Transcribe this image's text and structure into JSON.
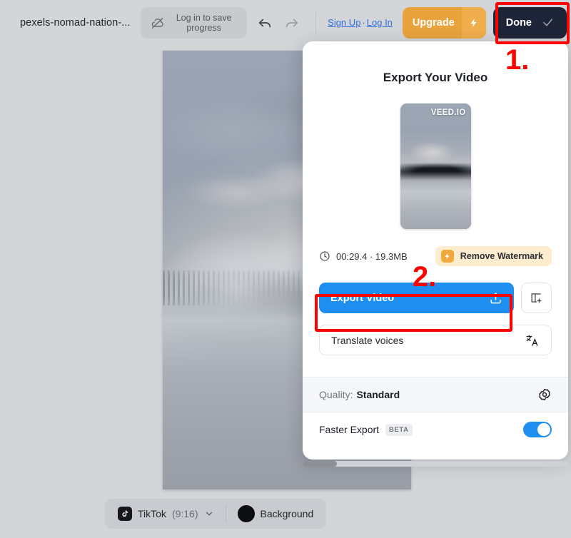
{
  "header": {
    "project_title": "pexels-nomad-nation-...",
    "save_pill": {
      "label": "Log in to save progress",
      "icon": "cloud-off-icon"
    },
    "undo_icon": "undo-arrow-icon",
    "redo_icon": "redo-arrow-icon",
    "auth": {
      "sign_up": "Sign Up",
      "separator": "·",
      "log_in": "Log In"
    },
    "upgrade": {
      "label": "Upgrade",
      "icon": "lightning-bolt-icon",
      "color": "#e8a33d"
    },
    "done": {
      "label": "Done",
      "icon": "check-icon",
      "color": "#1f2539"
    }
  },
  "panel": {
    "title": "Export Your Video",
    "thumbnail": {
      "watermark": "VEED.IO"
    },
    "meta": {
      "clock_icon": "clock-icon",
      "duration_size": "00:29.4 · 19.3MB"
    },
    "remove_watermark": {
      "label": "Remove Watermark",
      "icon": "lightning-bolt-icon"
    },
    "export_button": {
      "label": "Export Video",
      "icon": "upload-icon",
      "color": "#1f8ef1"
    },
    "add_button": {
      "icon": "add-layout-icon"
    },
    "translate_button": {
      "label": "Translate voices",
      "icon": "translate-icon"
    },
    "quality": {
      "label": "Quality:",
      "value": "Standard",
      "icon": "gear-icon"
    },
    "faster_export": {
      "label": "Faster Export",
      "badge": "BETA",
      "toggle_on": true
    }
  },
  "bottom_bar": {
    "ratio": {
      "icon": "tiktok-icon",
      "label": "TikTok",
      "value": "(9:16)",
      "chevron": "chevron-down-icon"
    },
    "background": {
      "label": "Background",
      "swatch_color": "#0c0d10"
    }
  },
  "annotations": {
    "step_one": "1.",
    "step_two": "2.",
    "highlight_color": "#ff0000"
  }
}
